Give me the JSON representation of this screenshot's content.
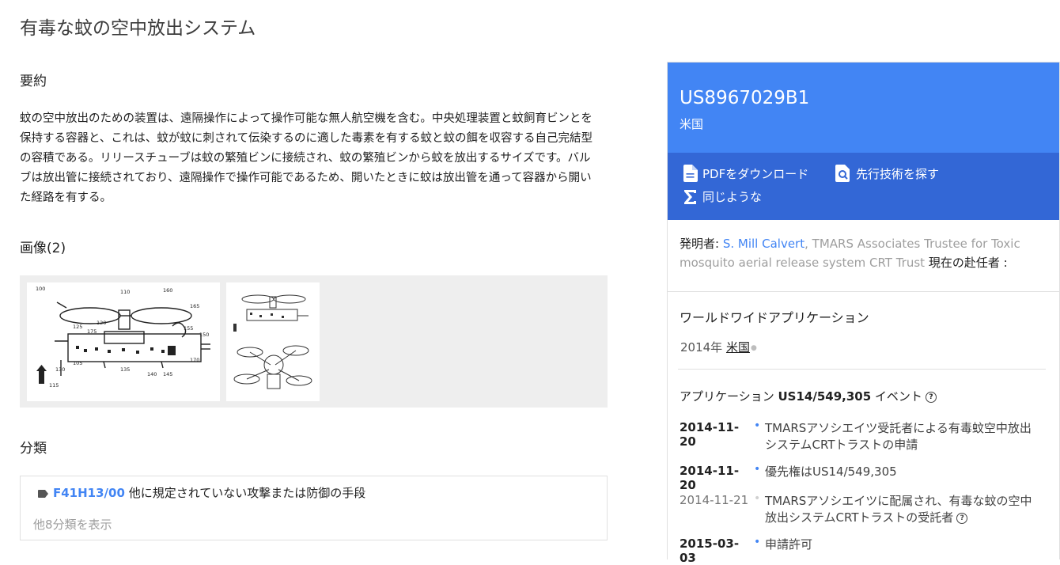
{
  "title": "有毒な蚊の空中放出システム",
  "abstract": {
    "heading": "要約",
    "text": "蚊の空中放出のための装置は、遠隔操作によって操作可能な無人航空機を含む。中央処理装置と蚊飼育ビンとを保持する容器と、これは、蚊が蚊に刺されて伝染するのに適した毒素を有する蚊と蚊の餌を収容する自己完結型の容積である。リリースチューブは蚊の繁殖ビンに接続され、蚊の繁殖ビンから蚊を放出するサイズです。バルブは放出管に接続されており、遠隔操作で操作可能であるため、開いたときに蚊は放出管を通って容器から開いた経路を有する。"
  },
  "images": {
    "heading": "画像(2)",
    "fig1_labels": [
      "100",
      "110",
      "160",
      "165",
      "125",
      "120",
      "175",
      "155",
      "150",
      "130",
      "105",
      "135",
      "140",
      "145",
      "170",
      "115"
    ]
  },
  "classifications": {
    "heading": "分類",
    "code": "F41H13/00",
    "description": "他に規定されていない攻撃または防御の手段",
    "more": "他8分類を表示"
  },
  "sidebar": {
    "pub_number": "US8967029B1",
    "country": "米国",
    "actions": {
      "pdf": "PDFをダウンロード",
      "prior_art": "先行技術を探す",
      "similar": "同じような"
    },
    "inventors": {
      "label": "発明者:",
      "name1": "S. Mill Calvert",
      "name2": "TMARS Associates Trustee for Toxic mosquito aerial release system CRT Trust",
      "assignee_label": "現在の赴任者 :"
    },
    "worldwide": {
      "heading": "ワールドワイドアプリケーション",
      "year": "2014年",
      "country": "米国"
    },
    "application": {
      "prefix": "アプリケーション",
      "number": "US14/549,305",
      "suffix": "イベント"
    },
    "events": [
      {
        "date": "2014-11-20",
        "text": "TMARSアソシエイツ受託者による有毒蚊空中放出システムCRTトラストの申請",
        "status": "active"
      },
      {
        "date": "2014-11-20",
        "text": "優先権はUS14/549,305",
        "status": "active"
      },
      {
        "date": "2014-11-21",
        "text": "TMARSアソシエイツに配属され、有毒な蚊の空中放出システムCRTトラストの受託者",
        "status": "inactive"
      },
      {
        "date": "2015-03-03",
        "text": "申請許可",
        "status": "active"
      }
    ]
  },
  "colors": {
    "accent": "#4285f4",
    "accent_dark": "#3367d6"
  }
}
